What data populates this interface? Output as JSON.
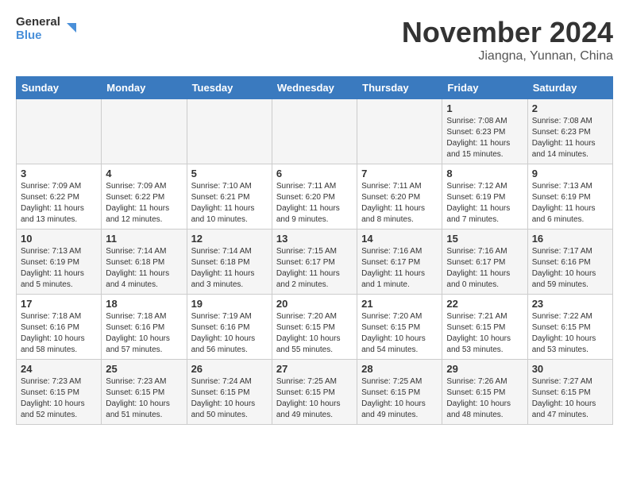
{
  "logo": {
    "line1": "General",
    "line2": "Blue"
  },
  "title": "November 2024",
  "location": "Jiangna, Yunnan, China",
  "weekdays": [
    "Sunday",
    "Monday",
    "Tuesday",
    "Wednesday",
    "Thursday",
    "Friday",
    "Saturday"
  ],
  "weeks": [
    [
      {
        "day": "",
        "info": ""
      },
      {
        "day": "",
        "info": ""
      },
      {
        "day": "",
        "info": ""
      },
      {
        "day": "",
        "info": ""
      },
      {
        "day": "",
        "info": ""
      },
      {
        "day": "1",
        "info": "Sunrise: 7:08 AM\nSunset: 6:23 PM\nDaylight: 11 hours\nand 15 minutes."
      },
      {
        "day": "2",
        "info": "Sunrise: 7:08 AM\nSunset: 6:23 PM\nDaylight: 11 hours\nand 14 minutes."
      }
    ],
    [
      {
        "day": "3",
        "info": "Sunrise: 7:09 AM\nSunset: 6:22 PM\nDaylight: 11 hours\nand 13 minutes."
      },
      {
        "day": "4",
        "info": "Sunrise: 7:09 AM\nSunset: 6:22 PM\nDaylight: 11 hours\nand 12 minutes."
      },
      {
        "day": "5",
        "info": "Sunrise: 7:10 AM\nSunset: 6:21 PM\nDaylight: 11 hours\nand 10 minutes."
      },
      {
        "day": "6",
        "info": "Sunrise: 7:11 AM\nSunset: 6:20 PM\nDaylight: 11 hours\nand 9 minutes."
      },
      {
        "day": "7",
        "info": "Sunrise: 7:11 AM\nSunset: 6:20 PM\nDaylight: 11 hours\nand 8 minutes."
      },
      {
        "day": "8",
        "info": "Sunrise: 7:12 AM\nSunset: 6:19 PM\nDaylight: 11 hours\nand 7 minutes."
      },
      {
        "day": "9",
        "info": "Sunrise: 7:13 AM\nSunset: 6:19 PM\nDaylight: 11 hours\nand 6 minutes."
      }
    ],
    [
      {
        "day": "10",
        "info": "Sunrise: 7:13 AM\nSunset: 6:19 PM\nDaylight: 11 hours\nand 5 minutes."
      },
      {
        "day": "11",
        "info": "Sunrise: 7:14 AM\nSunset: 6:18 PM\nDaylight: 11 hours\nand 4 minutes."
      },
      {
        "day": "12",
        "info": "Sunrise: 7:14 AM\nSunset: 6:18 PM\nDaylight: 11 hours\nand 3 minutes."
      },
      {
        "day": "13",
        "info": "Sunrise: 7:15 AM\nSunset: 6:17 PM\nDaylight: 11 hours\nand 2 minutes."
      },
      {
        "day": "14",
        "info": "Sunrise: 7:16 AM\nSunset: 6:17 PM\nDaylight: 11 hours\nand 1 minute."
      },
      {
        "day": "15",
        "info": "Sunrise: 7:16 AM\nSunset: 6:17 PM\nDaylight: 11 hours\nand 0 minutes."
      },
      {
        "day": "16",
        "info": "Sunrise: 7:17 AM\nSunset: 6:16 PM\nDaylight: 10 hours\nand 59 minutes."
      }
    ],
    [
      {
        "day": "17",
        "info": "Sunrise: 7:18 AM\nSunset: 6:16 PM\nDaylight: 10 hours\nand 58 minutes."
      },
      {
        "day": "18",
        "info": "Sunrise: 7:18 AM\nSunset: 6:16 PM\nDaylight: 10 hours\nand 57 minutes."
      },
      {
        "day": "19",
        "info": "Sunrise: 7:19 AM\nSunset: 6:16 PM\nDaylight: 10 hours\nand 56 minutes."
      },
      {
        "day": "20",
        "info": "Sunrise: 7:20 AM\nSunset: 6:15 PM\nDaylight: 10 hours\nand 55 minutes."
      },
      {
        "day": "21",
        "info": "Sunrise: 7:20 AM\nSunset: 6:15 PM\nDaylight: 10 hours\nand 54 minutes."
      },
      {
        "day": "22",
        "info": "Sunrise: 7:21 AM\nSunset: 6:15 PM\nDaylight: 10 hours\nand 53 minutes."
      },
      {
        "day": "23",
        "info": "Sunrise: 7:22 AM\nSunset: 6:15 PM\nDaylight: 10 hours\nand 53 minutes."
      }
    ],
    [
      {
        "day": "24",
        "info": "Sunrise: 7:23 AM\nSunset: 6:15 PM\nDaylight: 10 hours\nand 52 minutes."
      },
      {
        "day": "25",
        "info": "Sunrise: 7:23 AM\nSunset: 6:15 PM\nDaylight: 10 hours\nand 51 minutes."
      },
      {
        "day": "26",
        "info": "Sunrise: 7:24 AM\nSunset: 6:15 PM\nDaylight: 10 hours\nand 50 minutes."
      },
      {
        "day": "27",
        "info": "Sunrise: 7:25 AM\nSunset: 6:15 PM\nDaylight: 10 hours\nand 49 minutes."
      },
      {
        "day": "28",
        "info": "Sunrise: 7:25 AM\nSunset: 6:15 PM\nDaylight: 10 hours\nand 49 minutes."
      },
      {
        "day": "29",
        "info": "Sunrise: 7:26 AM\nSunset: 6:15 PM\nDaylight: 10 hours\nand 48 minutes."
      },
      {
        "day": "30",
        "info": "Sunrise: 7:27 AM\nSunset: 6:15 PM\nDaylight: 10 hours\nand 47 minutes."
      }
    ]
  ]
}
